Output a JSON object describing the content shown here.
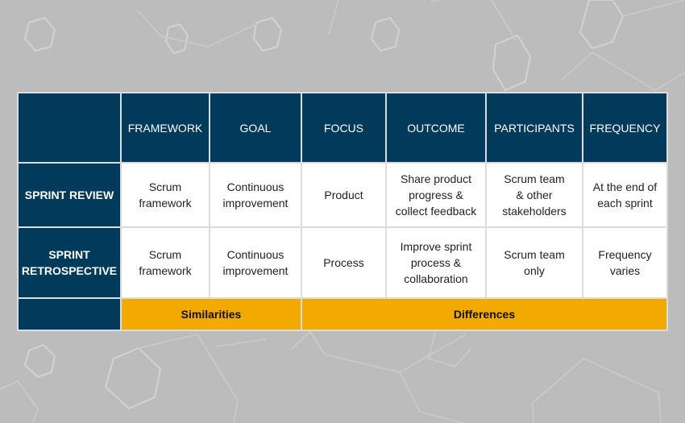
{
  "colors": {
    "navy": "#023a5b",
    "gold": "#f2a900",
    "background": "#bcbcbc",
    "cell": "#ffffff"
  },
  "columns": [
    "FRAMEWORK",
    "GOAL",
    "FOCUS",
    "OUTCOME",
    "PARTICIPANTS",
    "FREQUENCY"
  ],
  "rows": [
    {
      "label": "SPRINT REVIEW",
      "cells": [
        "Scrum\nframework",
        "Continuous\nimprovement",
        "Product",
        "Share product\nprogress &\ncollect feedback",
        "Scrum team\n& other\nstakeholders",
        "At the end of\neach sprint"
      ]
    },
    {
      "label": "SPRINT\nRETROSPECTIVE",
      "cells": [
        "Scrum\nframework",
        "Continuous\nimprovement",
        "Process",
        "Improve sprint\nprocess &\ncollaboration",
        "Scrum team\nonly",
        "Frequency\nvaries"
      ]
    }
  ],
  "footer": {
    "similarities": "Similarities",
    "differences": "Differences"
  }
}
